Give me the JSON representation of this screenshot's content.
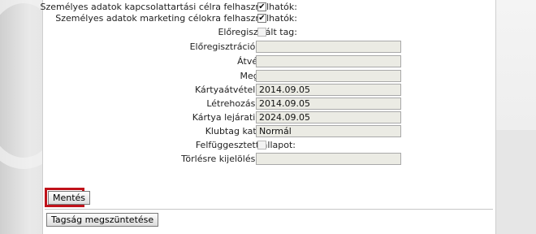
{
  "form": {
    "personal_contact_label": "Személyes adatok kapcsolattartási célra felhasználhatók:",
    "personal_contact_checked": true,
    "personal_marketing_label": "Személyes adatok marketing célokra felhasználhatók:",
    "personal_marketing_checked": true,
    "preregistered_label": "Előregisztrált tag:",
    "preregistered_checked": false,
    "preregistration_date_label": "Előregisztráció dátuma:",
    "preregistration_date_value": "",
    "pickup_place_label": "Átvételi hely:",
    "pickup_place_value": "",
    "note_label": "Megjegyzés:",
    "note_value": "",
    "card_pickup_date_label": "Kártyaátvétel dátuma:",
    "card_pickup_date_value": "2014.09.05",
    "created_date_label": "Létrehozás dátuma:",
    "created_date_value": "2014.09.05",
    "card_expiry_label": "Kártya lejárati dátuma:",
    "card_expiry_value": "2024.09.05",
    "club_category_label": "Klubtag kategóriája:",
    "club_category_value": "Normál",
    "suspended_label": "Felfüggesztett állapot:",
    "suspended_checked": false,
    "deletion_mark_date_label": "Törlésre kijelölés dátuma:",
    "deletion_mark_date_value": ""
  },
  "actions": {
    "save_label": "Mentés",
    "terminate_membership_label": "Tagság megszüntetése"
  },
  "colors": {
    "highlight": "#c0121a",
    "readonly_field_bg": "#ebebe4"
  },
  "icons": {
    "checkmark": "checkmark-icon"
  }
}
